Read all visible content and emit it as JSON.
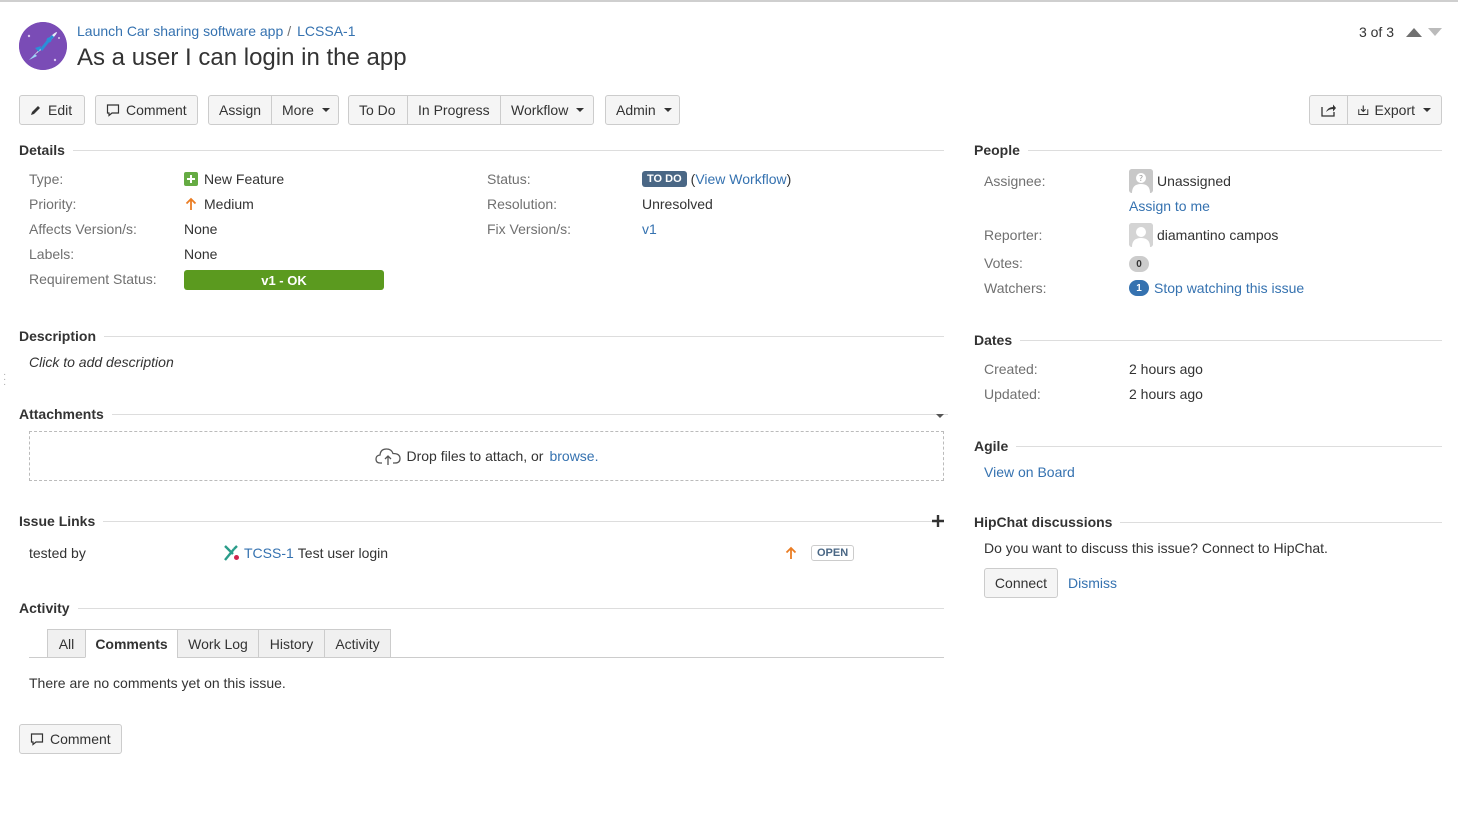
{
  "project": {
    "name": "Launch Car sharing software app",
    "issue_key": "LCSSA-1"
  },
  "issue": {
    "summary": "As a user I can login in the app"
  },
  "pager": {
    "text": "3 of 3"
  },
  "toolbar": {
    "edit": "Edit",
    "comment": "Comment",
    "assign": "Assign",
    "more": "More",
    "todo": "To Do",
    "in_progress": "In Progress",
    "workflow": "Workflow",
    "admin": "Admin",
    "export": "Export"
  },
  "details": {
    "heading": "Details",
    "type_label": "Type:",
    "type_value": "New Feature",
    "priority_label": "Priority:",
    "priority_value": "Medium",
    "affects_label": "Affects Version/s:",
    "affects_value": "None",
    "labels_label": "Labels:",
    "labels_value": "None",
    "req_label": "Requirement Status:",
    "req_value": "v1 - OK",
    "status_label": "Status:",
    "status_value": "TO DO",
    "view_workflow_open": "(",
    "view_workflow": "View Workflow",
    "view_workflow_close": ")",
    "resolution_label": "Resolution:",
    "resolution_value": "Unresolved",
    "fix_label": "Fix Version/s:",
    "fix_value": "v1"
  },
  "description": {
    "heading": "Description",
    "placeholder": "Click to add description"
  },
  "attachments": {
    "heading": "Attachments",
    "drop_text": "Drop files to attach, or",
    "browse": "browse."
  },
  "issue_links": {
    "heading": "Issue Links",
    "relation": "tested by",
    "key": "TCSS-1",
    "summary": "Test user login",
    "status": "OPEN"
  },
  "activity": {
    "heading": "Activity",
    "tabs": [
      "All",
      "Comments",
      "Work Log",
      "History",
      "Activity"
    ],
    "empty": "There are no comments yet on this issue.",
    "comment_button": "Comment"
  },
  "people": {
    "heading": "People",
    "assignee_label": "Assignee:",
    "assignee_value": "Unassigned",
    "assign_to_me": "Assign to me",
    "reporter_label": "Reporter:",
    "reporter_value": "diamantino campos",
    "votes_label": "Votes:",
    "votes_count": "0",
    "watchers_label": "Watchers:",
    "watchers_count": "1",
    "stop_watching": "Stop watching this issue"
  },
  "dates": {
    "heading": "Dates",
    "created_label": "Created:",
    "created_value": "2 hours ago",
    "updated_label": "Updated:",
    "updated_value": "2 hours ago"
  },
  "agile": {
    "heading": "Agile",
    "view_on_board": "View on Board"
  },
  "hipchat": {
    "heading": "HipChat discussions",
    "prompt": "Do you want to discuss this issue? Connect to HipChat.",
    "connect": "Connect",
    "dismiss": "Dismiss"
  },
  "colors": {
    "link": "#3572b0",
    "todo_lozenge": "#4a6785",
    "requirement_ok": "#5b9a1f",
    "new_feature": "#65ab43",
    "priority_medium": "#ea7d24"
  }
}
